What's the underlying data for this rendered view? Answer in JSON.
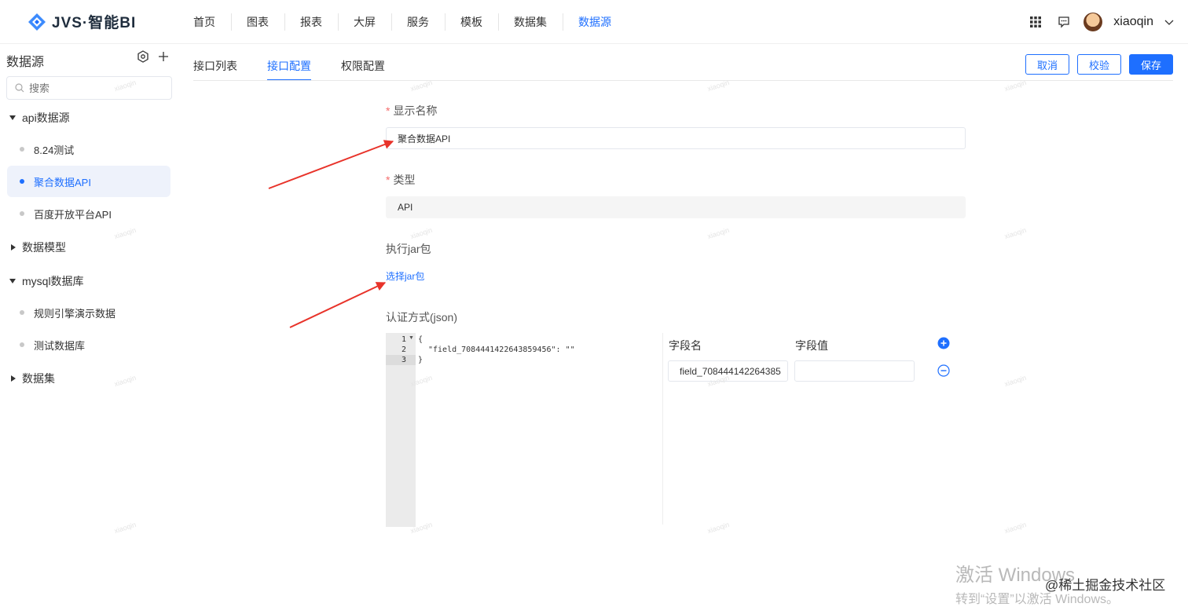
{
  "app": {
    "logo_text": "JVS·智能BI",
    "accent": "#1e6fff"
  },
  "nav": [
    {
      "label": "首页"
    },
    {
      "label": "图表"
    },
    {
      "label": "报表"
    },
    {
      "label": "大屏"
    },
    {
      "label": "服务"
    },
    {
      "label": "模板"
    },
    {
      "label": "数据集"
    },
    {
      "label": "数据源",
      "active": true
    }
  ],
  "user": {
    "name": "xiaoqin"
  },
  "sidebar": {
    "title": "数据源",
    "search_placeholder": "搜索",
    "groups": [
      {
        "label": "api数据源",
        "expanded": true,
        "items": [
          {
            "label": "8.24测试"
          },
          {
            "label": "聚合数据API",
            "active": true
          },
          {
            "label": "百度开放平台API"
          }
        ]
      },
      {
        "label": "数据模型",
        "expanded": false
      },
      {
        "label": "mysql数据库",
        "expanded": true,
        "items": [
          {
            "label": "规则引擎演示数据"
          },
          {
            "label": "测试数据库"
          }
        ]
      },
      {
        "label": "数据集",
        "expanded": false
      }
    ]
  },
  "tabs": [
    {
      "label": "接口列表"
    },
    {
      "label": "接口配置",
      "active": true
    },
    {
      "label": "权限配置"
    }
  ],
  "actions": {
    "cancel": "取消",
    "verify": "校验",
    "save": "保存"
  },
  "form": {
    "name_label": "显示名称",
    "name_value": "聚合数据API",
    "type_label": "类型",
    "type_value": "API",
    "jar_label": "执行jar包",
    "jar_link": "选择jar包",
    "auth_label": "认证方式(json)"
  },
  "editor": {
    "line_numbers": [
      "1",
      "2",
      "3"
    ],
    "lines": [
      "{",
      "\"field_7084441422643859456\": \"\"",
      "}"
    ]
  },
  "kv": {
    "name_header": "字段名",
    "value_header": "字段值",
    "rows": [
      {
        "name": "field_708444142264385",
        "value": ""
      }
    ]
  },
  "watermark": "xiaoqin",
  "os_overlay": {
    "line1": "激活 Windows",
    "line2": "转到“设置”以激活 Windows。",
    "credit": "@稀土掘金技术社区"
  }
}
